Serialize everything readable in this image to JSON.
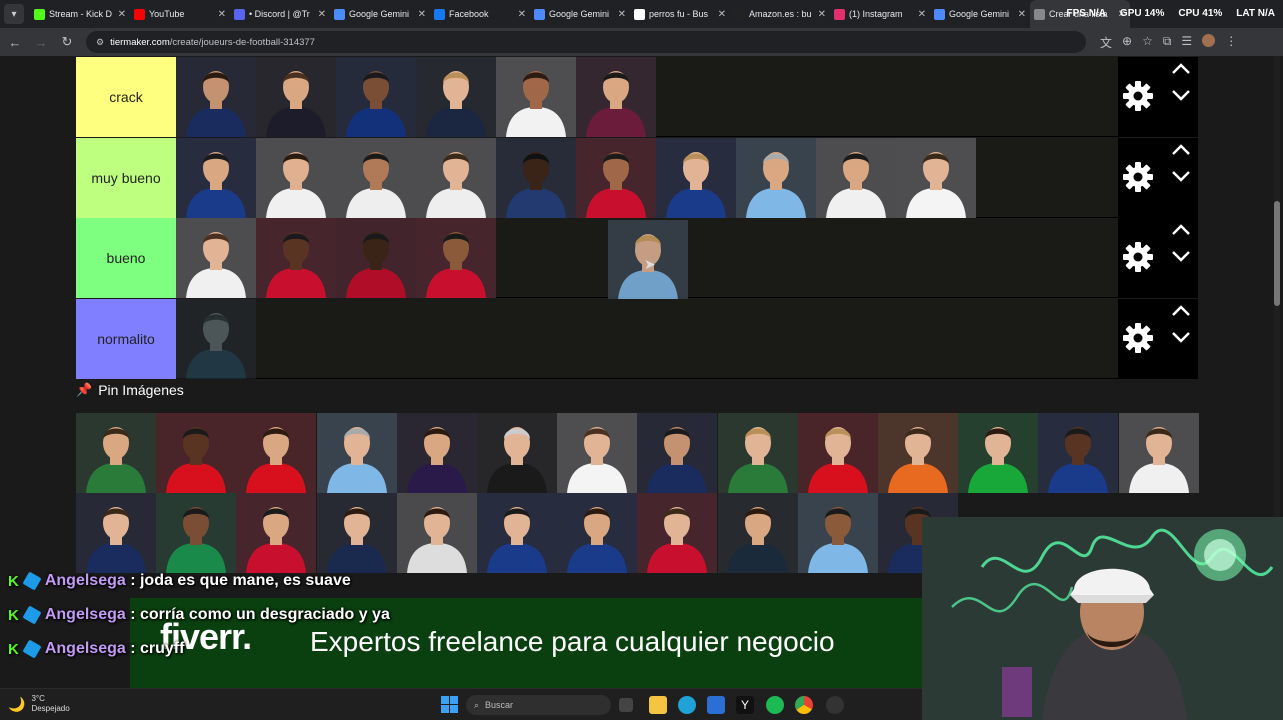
{
  "tabs": [
    {
      "title": "Stream - Kick D",
      "icon": "kick-icon",
      "color": "#53fc18"
    },
    {
      "title": "YouTube",
      "icon": "youtube-icon",
      "color": "#ff0000"
    },
    {
      "title": "• Discord | @Tr",
      "icon": "discord-icon",
      "color": "#5865f2"
    },
    {
      "title": "Google Gemini",
      "icon": "gemini-icon",
      "color": "#4a8cff"
    },
    {
      "title": "Facebook",
      "icon": "facebook-icon",
      "color": "#1877f2"
    },
    {
      "title": "Google Gemini",
      "icon": "gemini-icon",
      "color": "#4a8cff"
    },
    {
      "title": "perros fu - Bus",
      "icon": "google-icon",
      "color": "#ffffff"
    },
    {
      "title": "Amazon.es : bu",
      "icon": "amazon-icon",
      "color": "#222222"
    },
    {
      "title": "(1) Instagram",
      "icon": "instagram-icon",
      "color": "#e1306c"
    },
    {
      "title": "Google Gemini",
      "icon": "gemini-icon",
      "color": "#4a8cff"
    },
    {
      "title": "Crear una lista",
      "icon": "tiermaker-icon",
      "color": "#888888"
    }
  ],
  "hud": {
    "fps": "FPS N/A",
    "gpu": "GPU 14%",
    "cpu": "CPU 41%",
    "lat": "LAT N/A"
  },
  "url": {
    "host": "tiermaker.com",
    "path": "/create/joueurs-de-football-314377"
  },
  "tiers": [
    {
      "label": "crack",
      "color": "#ffff7f",
      "players": [
        {
          "kit": "#1a2b5e",
          "skin": "#c49271",
          "hair": "#2a1a10"
        },
        {
          "kit": "#1c1c2a",
          "skin": "#d9a883",
          "hair": "#4a3020"
        },
        {
          "kit": "#13307a",
          "skin": "#7a4e34",
          "hair": "#1a1a1a"
        },
        {
          "kit": "#1b2740",
          "skin": "#e2b496",
          "hair": "#b89058"
        },
        {
          "kit": "#f2f2f2",
          "skin": "#a06848",
          "hair": "#2a1a10"
        },
        {
          "kit": "#6a1c3a",
          "skin": "#d9a883",
          "hair": "#1a1a1a"
        }
      ]
    },
    {
      "label": "muy bueno",
      "color": "#bfff7f",
      "players": [
        {
          "kit": "#1a3a8a",
          "skin": "#d9a883",
          "hair": "#1a1a1a"
        },
        {
          "kit": "#f0f0f0",
          "skin": "#e0b090",
          "hair": "#2a1a10"
        },
        {
          "kit": "#eeeeee",
          "skin": "#b07a58",
          "hair": "#1a1a1a"
        },
        {
          "kit": "#eeeeee",
          "skin": "#e2b496",
          "hair": "#3a2818"
        },
        {
          "kit": "#233a70",
          "skin": "#3a2418",
          "hair": "#111111"
        },
        {
          "kit": "#c8102e",
          "skin": "#a06848",
          "hair": "#1a1a1a"
        },
        {
          "kit": "#1a3a8a",
          "skin": "#e2b496",
          "hair": "#b89058"
        },
        {
          "kit": "#7fb8e6",
          "skin": "#d9a883",
          "hair": "#aaaaaa"
        },
        {
          "kit": "#f0f0f0",
          "skin": "#d9a883",
          "hair": "#1a1a1a"
        },
        {
          "kit": "#f4f4f4",
          "skin": "#e2b496",
          "hair": "#3a2818"
        }
      ]
    },
    {
      "label": "bueno",
      "color": "#7fff7f",
      "players": [
        {
          "kit": "#f0f0f0",
          "skin": "#e2b496",
          "hair": "#4a3020"
        },
        {
          "kit": "#c8102e",
          "skin": "#5a3422",
          "hair": "#1a1a1a"
        },
        {
          "kit": "#b00e28",
          "skin": "#3a2418",
          "hair": "#1a1a1a"
        },
        {
          "kit": "#c8102e",
          "skin": "#8a5a3a",
          "hair": "#1a1a1a"
        }
      ],
      "dragging": {
        "kit": "#7fb8e6",
        "skin": "#e2b496",
        "hair": "#d0a060"
      }
    },
    {
      "label": "normalito",
      "color": "#7f7fff",
      "players": [
        {
          "kit": "#2a5a7a",
          "skin": "#8aa0a8",
          "hair": "#3a4a50"
        }
      ]
    }
  ],
  "pin_section": {
    "icon": "pushpin-icon",
    "label": "Pin Imágenes"
  },
  "pins_row1": [
    {
      "kit": "#2a7a3a",
      "skin": "#d9a883",
      "hair": "#3a2818"
    },
    {
      "kit": "#d8101e",
      "skin": "#5a3422",
      "hair": "#1a1a1a"
    },
    {
      "kit": "#d8101e",
      "skin": "#d9a883",
      "hair": "#2a1a10"
    },
    {
      "kit": "#7fb8e6",
      "skin": "#e2b496",
      "hair": "#aaaaaa"
    },
    {
      "kit": "#2a1a4a",
      "skin": "#d9a883",
      "hair": "#2a1a10"
    },
    {
      "kit": "#1a1a1a",
      "skin": "#e2b496",
      "hair": "#cccccc"
    },
    {
      "kit": "#f4f4f4",
      "skin": "#e2b496",
      "hair": "#4a3020"
    },
    {
      "kit": "#1a2b5e",
      "skin": "#c49271",
      "hair": "#1a1a1a"
    },
    {
      "kit": "#2a7a3a",
      "skin": "#e2b496",
      "hair": "#b89058"
    },
    {
      "kit": "#d8101e",
      "skin": "#e2b496",
      "hair": "#b89058"
    },
    {
      "kit": "#e86a20",
      "skin": "#e2b496",
      "hair": "#3a2818"
    },
    {
      "kit": "#18a83a",
      "skin": "#e2b496",
      "hair": "#2a1a10"
    },
    {
      "kit": "#1a3a8a",
      "skin": "#5a3422",
      "hair": "#1a1a1a"
    },
    {
      "kit": "#f0f0f0",
      "skin": "#e2b496",
      "hair": "#3a2818"
    }
  ],
  "pins_row2": [
    {
      "kit": "#1a2b5e",
      "skin": "#e2b496",
      "hair": "#3a2818"
    },
    {
      "kit": "#1a8a4a",
      "skin": "#7a4e34",
      "hair": "#1a1a1a"
    },
    {
      "kit": "#c8102e",
      "skin": "#d9a883",
      "hair": "#1a1a1a"
    },
    {
      "kit": "#1a2a4e",
      "skin": "#e2b496",
      "hair": "#2a1a10"
    },
    {
      "kit": "#dddddd",
      "skin": "#e2b496",
      "hair": "#2a1a10"
    },
    {
      "kit": "#1a3a8a",
      "skin": "#e2b496",
      "hair": "#1a1a1a"
    },
    {
      "kit": "#1a3a8a",
      "skin": "#d9a883",
      "hair": "#2a1a10"
    },
    {
      "kit": "#c8102e",
      "skin": "#e2b496",
      "hair": "#3a2818"
    },
    {
      "kit": "#1a2a3a",
      "skin": "#d9a883",
      "hair": "#2a1a10"
    },
    {
      "kit": "#7fb8e6",
      "skin": "#8a5a3a",
      "hair": "#1a1a1a"
    },
    {
      "kit": "#1a2b5e",
      "skin": "#5a3422",
      "hair": "#1a1a1a"
    }
  ],
  "chat": [
    {
      "user": "Angelsega",
      "message": "joda es que mane, es suave"
    },
    {
      "user": "Angelsega",
      "message": "corría como un desgraciado y ya"
    },
    {
      "user": "Angelsega",
      "message": "cruyff"
    }
  ],
  "ad": {
    "logo": "fiverr.",
    "tagline": "Expertos freelance para cualquier negocio"
  },
  "taskbar": {
    "temp": "3°C",
    "weather": "Despejado",
    "search_placeholder": "Buscar"
  }
}
